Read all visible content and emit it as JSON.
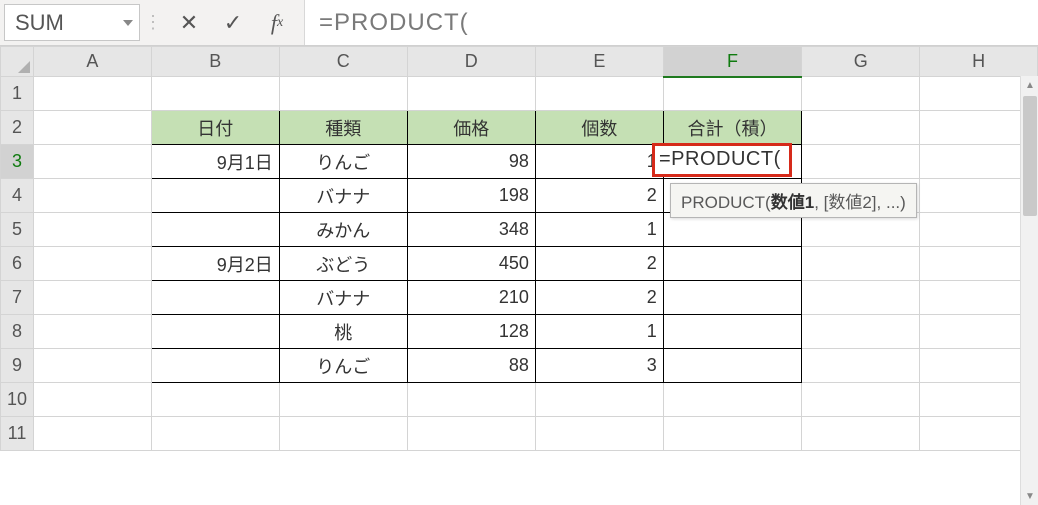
{
  "formula_bar": {
    "name_box": "SUM",
    "formula_text": "=PRODUCT("
  },
  "columns": [
    "A",
    "B",
    "C",
    "D",
    "E",
    "F",
    "G",
    "H"
  ],
  "rows": [
    "1",
    "2",
    "3",
    "4",
    "5",
    "6",
    "7",
    "8",
    "9",
    "10",
    "11"
  ],
  "active": {
    "col": "F",
    "row": "3"
  },
  "table": {
    "headers": {
      "B": "日付",
      "C": "種類",
      "D": "価格",
      "E": "個数",
      "F": "合計（積）"
    },
    "rows": [
      {
        "B": "9月1日",
        "C": "りんご",
        "D": "98",
        "E": "1"
      },
      {
        "B": "",
        "C": "バナナ",
        "D": "198",
        "E": "2"
      },
      {
        "B": "",
        "C": "みかん",
        "D": "348",
        "E": "1"
      },
      {
        "B": "9月2日",
        "C": "ぶどう",
        "D": "450",
        "E": "2"
      },
      {
        "B": "",
        "C": "バナナ",
        "D": "210",
        "E": "2"
      },
      {
        "B": "",
        "C": "桃",
        "D": "128",
        "E": "1"
      },
      {
        "B": "",
        "C": "りんご",
        "D": "88",
        "E": "3"
      }
    ]
  },
  "edit_cell_text": "=PRODUCT(",
  "tooltip": {
    "fn": "PRODUCT(",
    "arg_bold": "数値1",
    "rest": ", [数値2], ...)"
  }
}
